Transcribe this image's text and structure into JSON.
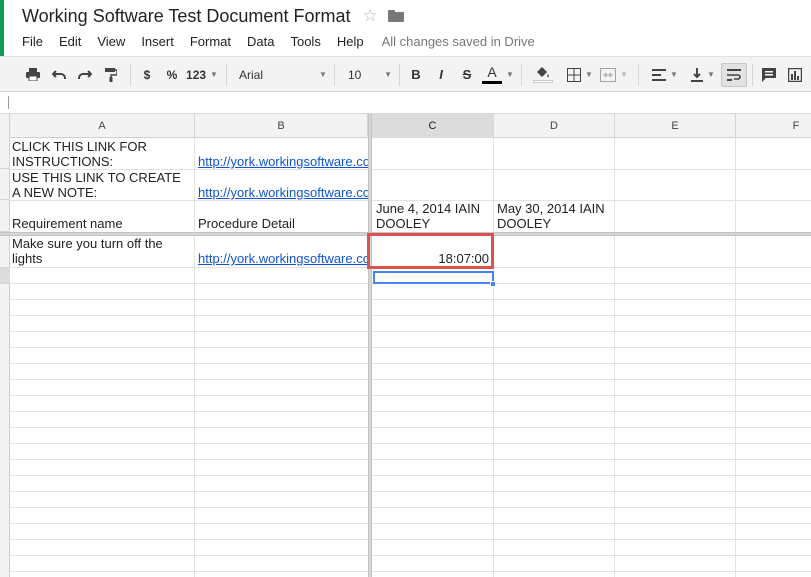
{
  "document": {
    "title": "Working Software Test Document Format",
    "star_icon": "star-icon",
    "folder_icon": "folder-icon"
  },
  "menu": {
    "items": [
      "File",
      "Edit",
      "View",
      "Insert",
      "Format",
      "Data",
      "Tools",
      "Help"
    ],
    "save_status": "All changes saved in Drive"
  },
  "toolbar": {
    "currency": "$",
    "percent": "%",
    "number_format": "123",
    "font": "Arial",
    "font_size": "10",
    "bold": "B",
    "italic": "I",
    "strikethrough": "S",
    "text_color_label": "A",
    "icons": [
      "print-icon",
      "undo-icon",
      "redo-icon",
      "paint-format-icon",
      "fill-color-icon",
      "borders-icon",
      "merge-cells-icon",
      "horizontal-align-icon",
      "vertical-align-icon",
      "text-wrap-icon",
      "insert-comment-icon",
      "insert-chart-icon"
    ]
  },
  "sheet": {
    "columns": [
      "A",
      "B",
      "C",
      "D",
      "E",
      "F"
    ],
    "selected_column": "C",
    "cells": {
      "a1": "CLICK THIS LINK FOR\nINSTRUCTIONS:",
      "b1": "http://york.workingsoftware.co",
      "a2": "USE THIS LINK TO CREATE\nA NEW NOTE:",
      "b2": "http://york.workingsoftware.co",
      "a3": "Requirement name",
      "b3": "Procedure Detail",
      "c3": "June 4, 2014 IAIN\nDOOLEY",
      "d3": "May 30, 2014 IAIN\nDOOLEY",
      "a4": "Make sure you turn off the\nlights",
      "b4": "http://york.workingsoftware.co",
      "c4": "18:07:00"
    }
  },
  "colors": {
    "accent": "#0f9d58",
    "link": "#1155cc",
    "highlight_box": "#d9534f",
    "selection": "#4285f4"
  }
}
